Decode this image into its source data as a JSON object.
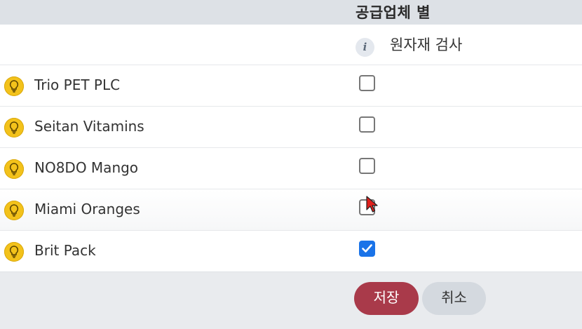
{
  "header": {
    "title": "공급업체 별"
  },
  "column": {
    "info_icon": "info-icon",
    "label": "원자재 검사"
  },
  "suppliers": [
    {
      "name": "Trio PET PLC",
      "checked": false
    },
    {
      "name": "Seitan Vitamins",
      "checked": false
    },
    {
      "name": "NO8DO Mango",
      "checked": false
    },
    {
      "name": "Miami Oranges",
      "checked": false
    },
    {
      "name": "Brit Pack",
      "checked": true
    }
  ],
  "actions": {
    "save_label": "저장",
    "cancel_label": "취소"
  },
  "colors": {
    "bulb": "#f3c21b",
    "checkbox_checked": "#1a73e8",
    "save_button": "#a93a4a",
    "cancel_button": "#d4d9df"
  }
}
